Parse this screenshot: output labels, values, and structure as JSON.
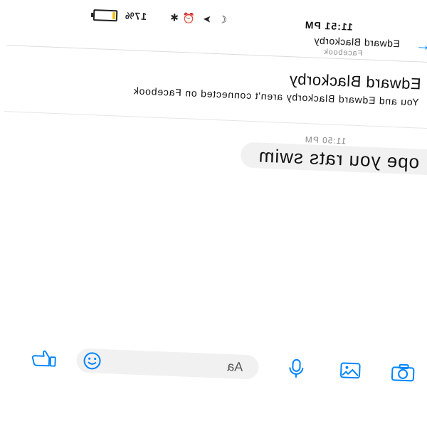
{
  "status_bar": {
    "time": "11:51 PM",
    "battery": "17%",
    "battery_level": 0.17
  },
  "header": {
    "name": "Edward Blackorby",
    "subtitle": "Facebook"
  },
  "contact_card": {
    "name": "Edward Blackorby",
    "subtitle": "You and Edward Blackorby aren't connected on Facebook"
  },
  "messages": [
    {
      "time": "11:50 PM",
      "text": "ope you  rats swim"
    }
  ],
  "composer": {
    "placeholder": "Aa"
  },
  "colors": {
    "accent": "#0084ff",
    "bubble": "#f1f1f1",
    "battery": "#f1c21b"
  },
  "icons": [
    "back-arrow-icon",
    "camera-icon",
    "image-icon",
    "microphone-icon",
    "emoji-icon",
    "thumbs-up-icon",
    "moon-icon",
    "location-icon",
    "alarm-icon",
    "bluetooth-icon"
  ]
}
